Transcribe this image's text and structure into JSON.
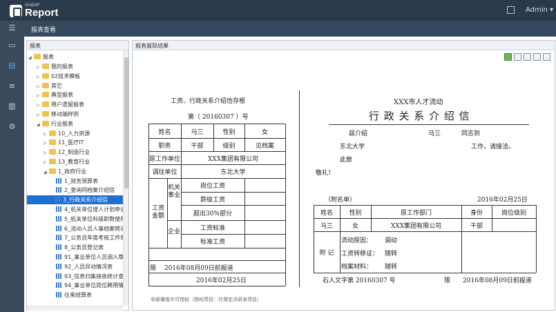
{
  "app": {
    "brand_small": "UniEAP",
    "brand": "Report",
    "user": "Admin ▾"
  },
  "header": {
    "title": "报表查看"
  },
  "left_panel": {
    "title": "报表"
  },
  "right_panel": {
    "title": "报表展现结果"
  },
  "tree": {
    "root": "报表",
    "items": [
      {
        "label": "我的报表",
        "type": "folder",
        "level": 1
      },
      {
        "label": "02技术模板",
        "type": "folder",
        "level": 1
      },
      {
        "label": "其它",
        "type": "folder",
        "level": 1
      },
      {
        "label": "典型报表",
        "type": "folder",
        "level": 1
      },
      {
        "label": "用户遗留报表",
        "type": "folder",
        "level": 1
      },
      {
        "label": "移动端样例",
        "type": "folder",
        "level": 1
      },
      {
        "label": "行业报表",
        "type": "folder",
        "level": 1,
        "open": true
      },
      {
        "label": "10_人力资源",
        "type": "folder",
        "level": 2
      },
      {
        "label": "11_医疗IT",
        "type": "folder",
        "level": 2
      },
      {
        "label": "12_制造行业",
        "type": "folder",
        "level": 2
      },
      {
        "label": "13_教育行业",
        "type": "folder",
        "level": 2
      },
      {
        "label": "1_政府行业",
        "type": "folder",
        "level": 2,
        "open": true
      },
      {
        "label": "1_财务预算表",
        "type": "report",
        "level": 3
      },
      {
        "label": "2_查询同档案介绍信",
        "type": "report",
        "level": 3
      },
      {
        "label": "3_行政关系介绍信",
        "type": "report",
        "level": 3,
        "selected": true
      },
      {
        "label": "4_机关单位增人计划申请表",
        "type": "report",
        "level": 3
      },
      {
        "label": "5_机关单位科级职数使用审",
        "type": "report",
        "level": 3
      },
      {
        "label": "6_流动人员人事档案转递通",
        "type": "report",
        "level": 3
      },
      {
        "label": "7_公务员年度考核工作审核",
        "type": "report",
        "level": 3
      },
      {
        "label": "8_公务员登记表",
        "type": "report",
        "level": 3
      },
      {
        "label": "91_事业单位人员调入审批",
        "type": "report",
        "level": 3
      },
      {
        "label": "92_人员异动情况表",
        "type": "report",
        "level": 3
      },
      {
        "label": "93_信息归集接收统计查询",
        "type": "report",
        "level": 3
      },
      {
        "label": "94_事业单位岗位聘用情况",
        "type": "report",
        "level": 3
      },
      {
        "label": "往来结算表",
        "type": "report",
        "level": 3
      }
    ]
  },
  "stub": {
    "title": "工资、行政关系介绍信存根",
    "number_line": "第（  20160307  ）号",
    "name_label": "姓名",
    "name": "马三",
    "gender_label": "性别",
    "gender": "女",
    "position_label": "职务",
    "position": "干部",
    "grade_label": "级别",
    "grade": "见档案",
    "orig_unit_label": "原工作单位",
    "orig_unit": "XXX集团有限公司",
    "dest_unit_label": "调往单位",
    "dest_unit": "东北大学",
    "wage_label": "工资金额",
    "gov_label": "机关事业",
    "ent_label": "企业",
    "gov_rows": [
      "岗位工资",
      "薪级工资",
      "超出30%部分"
    ],
    "ent_rows": [
      "工资标准",
      "标准工资"
    ],
    "deadline": "限　 2016年08月09日前报道",
    "date": "2016年02月25日"
  },
  "letter": {
    "org": "XXX市人才流动",
    "title": "行 政 关 系 介 绍 信",
    "intro_label": "兹介绍",
    "name": "马三",
    "comrade": "同志到",
    "dest": "东北大学",
    "work_text": "工作，请接洽。",
    "closing1": "此致",
    "closing2": "敬礼！",
    "attach_label": "（附名单）",
    "date": "2016年02月25日",
    "table_headers": [
      "姓名",
      "性别",
      "原工作部门",
      "身份",
      "岗位级别"
    ],
    "table_row": [
      "马三",
      "女",
      "XXX集团有限公司",
      "干部",
      ""
    ],
    "notes_label": "附 记",
    "notes": [
      {
        "label": "流动原因：",
        "value": "调动"
      },
      {
        "label": "工资转移证：",
        "value": "随转"
      },
      {
        "label": "档案材料：",
        "value": "随转"
      }
    ],
    "footer_left": "石人文字第  20160307  号",
    "footer_right_label": "限",
    "footer_right": "2016年08月09日前报道"
  },
  "footer_note": "非部署版许可授权（授权项目：社保定点研发项目）"
}
